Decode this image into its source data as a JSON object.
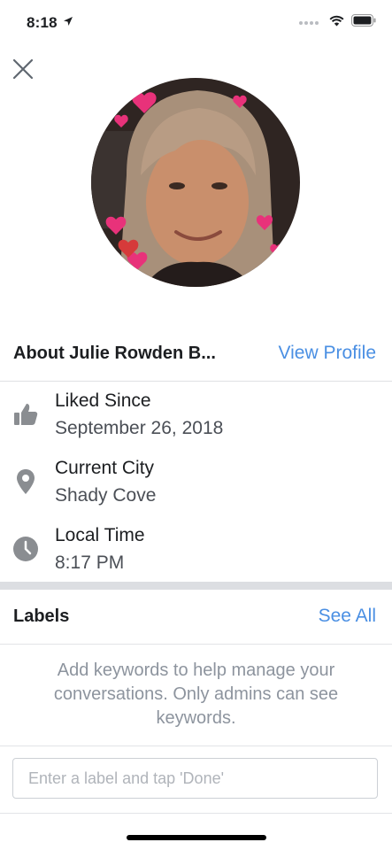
{
  "status_bar": {
    "time": "8:18",
    "icons": [
      "location-arrow-icon",
      "signal-dots-icon",
      "wifi-icon",
      "battery-icon"
    ]
  },
  "header": {
    "close_icon": "close-icon"
  },
  "profile": {
    "about_title": "About Julie Rowden B...",
    "view_profile_label": "View Profile"
  },
  "info": [
    {
      "icon": "thumbs-up-icon",
      "label": "Liked Since",
      "value": "September 26, 2018"
    },
    {
      "icon": "location-pin-icon",
      "label": "Current City",
      "value": "Shady Cove"
    },
    {
      "icon": "clock-icon",
      "label": "Local Time",
      "value": "8:17 PM"
    }
  ],
  "labels": {
    "title": "Labels",
    "see_all_label": "See All",
    "help_text": "Add keywords to help manage your conversations. Only admins can see keywords.",
    "input_placeholder": "Enter a label and tap 'Done'",
    "input_value": ""
  },
  "colors": {
    "accent": "#4a8fe3",
    "icon_gray": "#8a8d91",
    "divider": "#dcdee2"
  }
}
